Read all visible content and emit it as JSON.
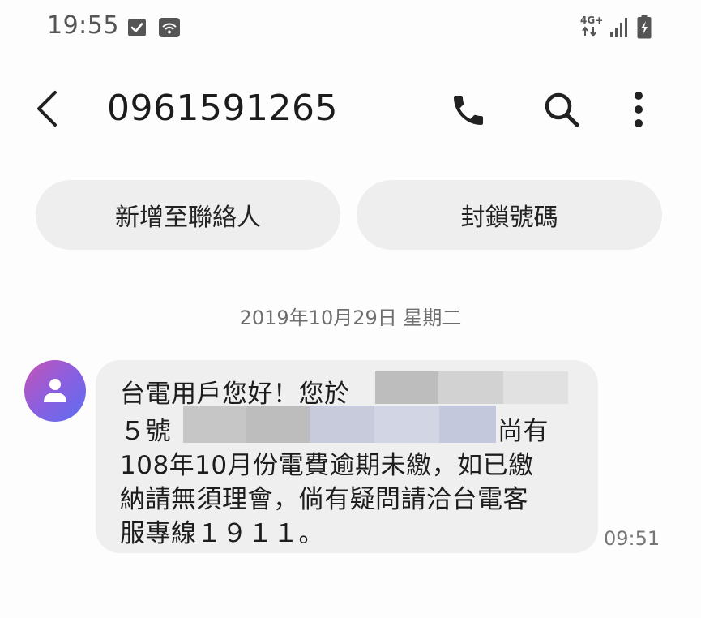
{
  "status_bar": {
    "time": "19:55",
    "network_label": "4G+",
    "icons": [
      "notification-check-icon",
      "wifi-calling-icon",
      "network-4g-icon",
      "signal-icon",
      "battery-charging-icon"
    ]
  },
  "header": {
    "contact_number": "0961591265",
    "icons": [
      "back-arrow-icon",
      "phone-call-icon",
      "search-icon",
      "more-options-icon"
    ]
  },
  "actions": {
    "add_contact_label": "新增至聯絡人",
    "block_number_label": "封鎖號碼"
  },
  "conversation": {
    "date_separator": "2019年10月29日 星期二",
    "messages": [
      {
        "lines": [
          "台電用戶您好！您於",
          "５號",
          "尚有",
          "108年10月份電費逾期未繳，如已繳",
          "納請無須理會，倘有疑問請洽台電客",
          "服專線１９１１。"
        ],
        "time": "09:51",
        "redacted": true
      }
    ]
  },
  "colors": {
    "bubble_bg": "#efefef",
    "pill_bg": "#eeeeee",
    "avatar_gradient_start": "#c653b4",
    "avatar_gradient_end": "#5b6ff0",
    "text_primary": "#1d1d1d",
    "text_secondary": "#6f6f6f"
  }
}
